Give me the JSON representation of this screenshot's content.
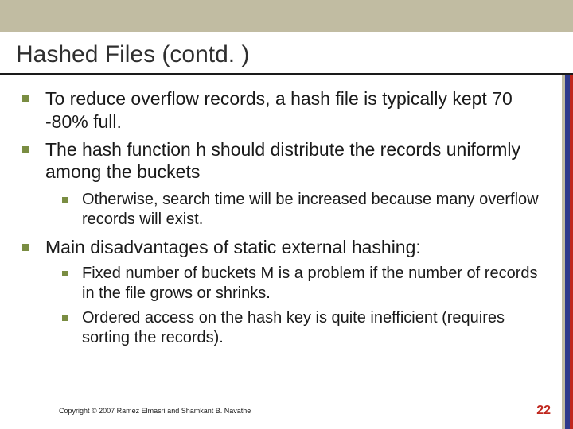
{
  "title": "Hashed Files (contd. )",
  "bullets": {
    "b1": "To reduce overflow records, a hash file is typically kept 70 -80% full.",
    "b2": "The hash function h should distribute the records uniformly among the buckets",
    "b2_1": "Otherwise, search time will be increased because many overflow records will exist.",
    "b3": "Main disadvantages of static external hashing:",
    "b3_1": "Fixed number of buckets M is a problem if the number of records in the file grows or shrinks.",
    "b3_2": "Ordered access on the hash key is quite inefficient (requires  sorting the records)."
  },
  "copyright": "Copyright © 2007 Ramez Elmasri and Shamkant B. Navathe",
  "page_number": "22"
}
